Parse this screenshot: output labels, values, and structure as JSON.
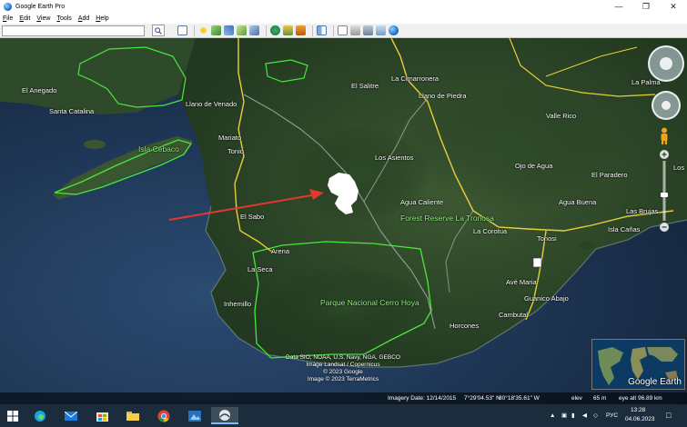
{
  "window": {
    "title": "Google Earth Pro",
    "minimize": "—",
    "maximize": "❐",
    "close": "✕"
  },
  "menu": [
    {
      "key": "F",
      "rest": "ile"
    },
    {
      "key": "E",
      "rest": "dit"
    },
    {
      "key": "V",
      "rest": "iew"
    },
    {
      "key": "T",
      "rest": "ools"
    },
    {
      "key": "A",
      "rest": "dd"
    },
    {
      "key": "H",
      "rest": "elp"
    }
  ],
  "search": {
    "value": "",
    "placeholder": ""
  },
  "map": {
    "labels": [
      {
        "text": "El Anegado"
      },
      {
        "text": "Santa Catalina"
      },
      {
        "text": "Llano de Venado"
      },
      {
        "text": "El Salitre"
      },
      {
        "text": "La Cimarronera"
      },
      {
        "text": "Llano de Piedra"
      },
      {
        "text": "La Palma"
      },
      {
        "text": "Valle Rico"
      },
      {
        "text": "Mariato"
      },
      {
        "text": "Tonio"
      },
      {
        "text": "Los Asientos"
      },
      {
        "text": "Ojo de Agua"
      },
      {
        "text": "El Paradero"
      },
      {
        "text": "Los"
      },
      {
        "text": "Agua Caliente"
      },
      {
        "text": "Agua Buena"
      },
      {
        "text": "Las Brujas"
      },
      {
        "text": "El Sabo"
      },
      {
        "text": "La Corotua"
      },
      {
        "text": "Tonosi"
      },
      {
        "text": "Isla Cañas"
      },
      {
        "text": "Arena"
      },
      {
        "text": "La Seca"
      },
      {
        "text": "Avé Maria"
      },
      {
        "text": "Guanico Abajo"
      },
      {
        "text": "Inhemillo"
      },
      {
        "text": "Cambutal"
      },
      {
        "text": "Horcones"
      }
    ],
    "park_labels": [
      {
        "text": "Isla Cébaco"
      },
      {
        "text": "Forest Reserve La Tronosa"
      },
      {
        "text": "Parque Nacional Cerro Hoya"
      }
    ],
    "attribution": [
      "Data SIO, NOAA, U.S. Navy, NGA, GEBCO",
      "Image Landsat / Copernicus",
      "© 2023 Google",
      "Image © 2023 TerraMetrics"
    ],
    "overview_brand": "Google Earth"
  },
  "status": {
    "imagery_date": "Imagery Date: 12/14/2015",
    "lat": "7°29'04.53\" N",
    "lon": "80°18'35.61\" W",
    "elev_label": "elev",
    "elev": "65 m",
    "eye_alt": "eye alt  96.89 km"
  },
  "taskbar": {
    "lang": "РУС",
    "time": "13:28",
    "date": "04.06.2023"
  },
  "colors": {
    "ocean": "#1d3757",
    "land": "#2f4a2a",
    "park_border": "#46e83c",
    "road": "#e8cf3a",
    "arrow": "#e0382e"
  }
}
